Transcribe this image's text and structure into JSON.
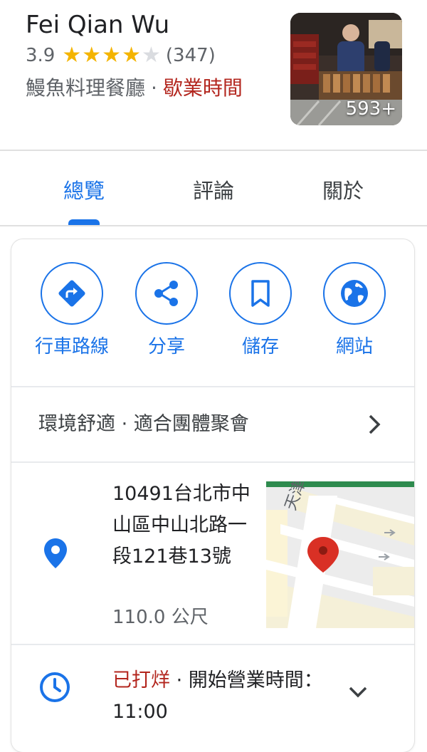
{
  "place": {
    "name": "Fei Qian Wu",
    "rating": "3.9",
    "stars_filled": 4,
    "stars_total": 5,
    "review_count": "(347)",
    "category": "鰻魚料理餐廳",
    "separator": "·",
    "hours_status": "歇業時間",
    "photo_count": "593+"
  },
  "tabs": [
    {
      "label": "總覽",
      "active": true
    },
    {
      "label": "評論",
      "active": false
    },
    {
      "label": "關於",
      "active": false
    }
  ],
  "actions": [
    {
      "label": "行車路線",
      "icon": "directions-icon"
    },
    {
      "label": "分享",
      "icon": "share-icon"
    },
    {
      "label": "儲存",
      "icon": "bookmark-icon"
    },
    {
      "label": "網站",
      "icon": "globe-icon"
    }
  ],
  "summary": {
    "text": "環境舒適 · 適合團體聚會"
  },
  "address": {
    "text": "10491台北市中山區中山北路一段121巷13號",
    "distance": "110.0 公尺",
    "map_street_label": "天津街"
  },
  "hours": {
    "closed_label": "已打烊",
    "separator": " · ",
    "opening_text": "開始營業時間：11:00"
  },
  "colors": {
    "accent": "#1a73e8",
    "star": "#f4b400",
    "closed": "#b3261e",
    "map_pin": "#d93025"
  }
}
